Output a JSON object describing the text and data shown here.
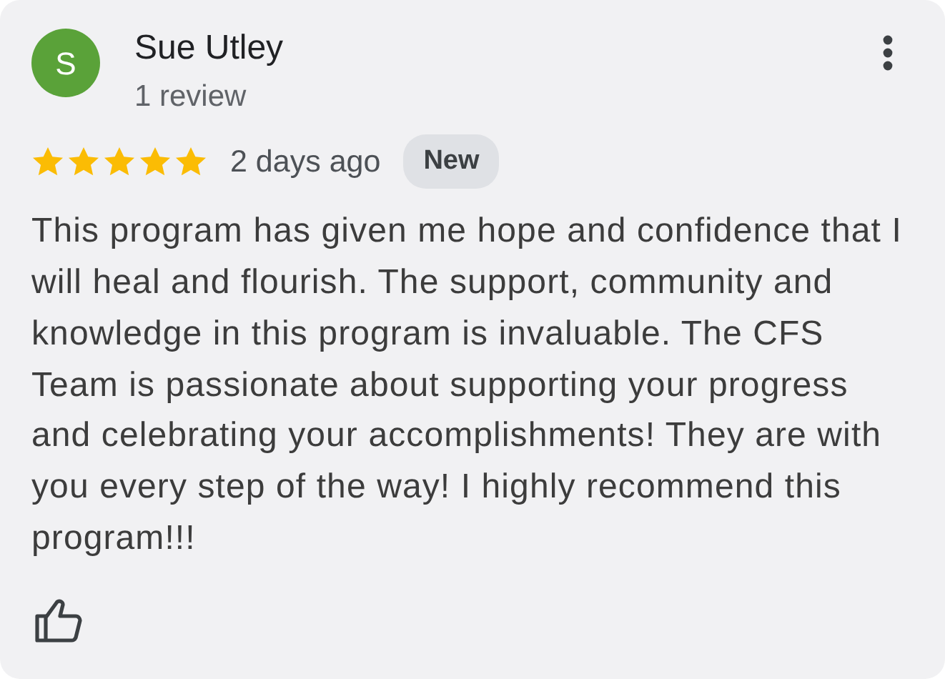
{
  "reviewer": {
    "initial": "S",
    "name": "Sue Utley",
    "review_count": "1 review"
  },
  "review": {
    "stars": 5,
    "time": "2 days ago",
    "badge": "New",
    "text": "This program has given me hope and confidence that I will heal and flourish. The support, community and knowledge in this program is invaluable. The CFS Team is passionate about supporting your progress and celebrating your accomplishments! They are with you every step of the way! I highly recommend this program!!!"
  }
}
